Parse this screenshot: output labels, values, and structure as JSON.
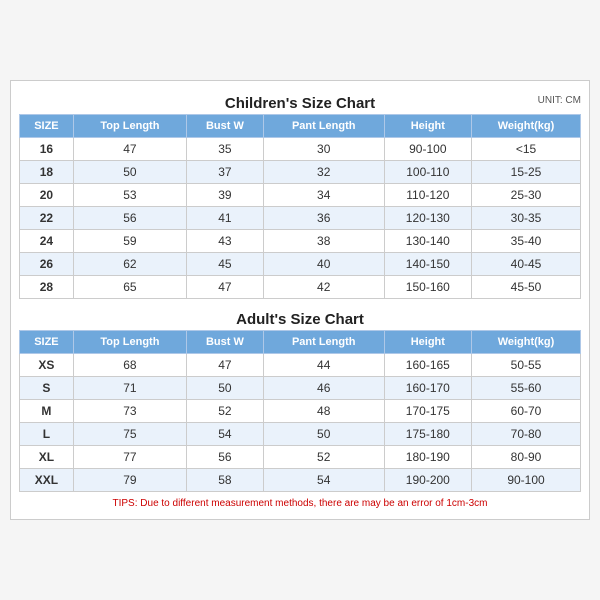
{
  "children_title": "Children's Size Chart",
  "adult_title": "Adult's Size Chart",
  "unit": "UNIT: CM",
  "headers": [
    "SIZE",
    "Top Length",
    "Bust W",
    "Pant Length",
    "Height",
    "Weight(kg)"
  ],
  "children_rows": [
    [
      "16",
      "47",
      "35",
      "30",
      "90-100",
      "<15"
    ],
    [
      "18",
      "50",
      "37",
      "32",
      "100-110",
      "15-25"
    ],
    [
      "20",
      "53",
      "39",
      "34",
      "110-120",
      "25-30"
    ],
    [
      "22",
      "56",
      "41",
      "36",
      "120-130",
      "30-35"
    ],
    [
      "24",
      "59",
      "43",
      "38",
      "130-140",
      "35-40"
    ],
    [
      "26",
      "62",
      "45",
      "40",
      "140-150",
      "40-45"
    ],
    [
      "28",
      "65",
      "47",
      "42",
      "150-160",
      "45-50"
    ]
  ],
  "adult_rows": [
    [
      "XS",
      "68",
      "47",
      "44",
      "160-165",
      "50-55"
    ],
    [
      "S",
      "71",
      "50",
      "46",
      "160-170",
      "55-60"
    ],
    [
      "M",
      "73",
      "52",
      "48",
      "170-175",
      "60-70"
    ],
    [
      "L",
      "75",
      "54",
      "50",
      "175-180",
      "70-80"
    ],
    [
      "XL",
      "77",
      "56",
      "52",
      "180-190",
      "80-90"
    ],
    [
      "XXL",
      "79",
      "58",
      "54",
      "190-200",
      "90-100"
    ]
  ],
  "tips": "TIPS: Due to different measurement methods, there are may be an error of 1cm-3cm"
}
